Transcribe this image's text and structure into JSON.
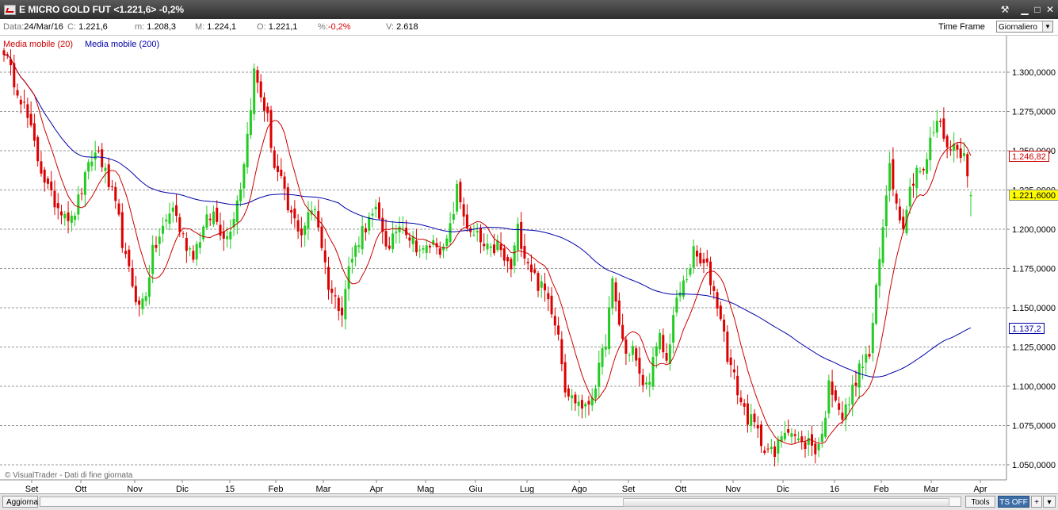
{
  "window": {
    "title": "E MICRO GOLD FUT <1.221,6> -0,2%",
    "buttons": [
      "tools-icon",
      "minimize-icon",
      "maximize-icon",
      "close-icon"
    ]
  },
  "info": {
    "data_label": "Data:",
    "data_value": "24/Mar/16",
    "c_label": "C:",
    "c_value": "1.221,6",
    "m_label": "m:",
    "m_value": "1.208,3",
    "M_label": "M:",
    "M_value": "1.224,1",
    "o_label": "O:",
    "o_value": "1.221,1",
    "pct_label": "%:",
    "pct_value": "-0,2%",
    "v_label": "V:",
    "v_value": "2.618",
    "timeframe_label": "Time Frame",
    "timeframe_value": "Giornaliero"
  },
  "legend": {
    "ma20": "Media mobile (20)",
    "ma200": "Media mobile (200)"
  },
  "tags": {
    "ma20_value": "1.246,82",
    "last_price": "1.221,6000",
    "ma200_value": "1.137,2"
  },
  "watermark": "© VisualTrader - Dati di fine giornata",
  "status": {
    "refresh": "Aggiorna",
    "tools": "Tools",
    "ts": "TS OFF",
    "plus": "+",
    "menu": "▾"
  },
  "colors": {
    "up": "#22cc22",
    "down": "#dd0000",
    "ma20": "#cc0000",
    "ma200": "#0000aa",
    "grid": "#999999",
    "last_price_bg": "#ffff00"
  },
  "chart_data": {
    "type": "candlestick",
    "instrument": "E MICRO GOLD FUT",
    "y_ticks": [
      "1.300,0000",
      "1.275,0000",
      "1.250,0000",
      "1.225,0000",
      "1.200,0000",
      "1.175,0000",
      "1.150,0000",
      "1.125,0000",
      "1.100,0000",
      "1.075,0000",
      "1.050,0000"
    ],
    "y_tick_values": [
      1300,
      1275,
      1250,
      1225,
      1200,
      1175,
      1150,
      1125,
      1100,
      1075,
      1050
    ],
    "ylim": [
      1038,
      1322
    ],
    "x_labels": [
      "Set",
      "Ott",
      "Nov",
      "Dic",
      "15",
      "Feb",
      "Mar",
      "Apr",
      "Mag",
      "Giu",
      "Lug",
      "Ago",
      "Set",
      "Ott",
      "Nov",
      "Dic",
      "16",
      "Feb",
      "Mar",
      "Apr"
    ],
    "close_anchors": [
      1315,
      1300,
      1290,
      1278,
      1262,
      1245,
      1232,
      1220,
      1215,
      1212,
      1205,
      1218,
      1232,
      1245,
      1250,
      1235,
      1222,
      1205,
      1180,
      1165,
      1150,
      1160,
      1185,
      1195,
      1205,
      1215,
      1200,
      1190,
      1185,
      1195,
      1205,
      1210,
      1200,
      1195,
      1210,
      1228,
      1260,
      1300,
      1285,
      1270,
      1240,
      1230,
      1212,
      1205,
      1198,
      1208,
      1215,
      1190,
      1165,
      1155,
      1150,
      1175,
      1188,
      1200,
      1205,
      1210,
      1200,
      1185,
      1200,
      1205,
      1195,
      1190,
      1185,
      1190,
      1192,
      1185,
      1200,
      1225,
      1210,
      1195,
      1195,
      1188,
      1185,
      1190,
      1180,
      1175,
      1200,
      1185,
      1175,
      1165,
      1160,
      1150,
      1135,
      1100,
      1092,
      1090,
      1085,
      1095,
      1110,
      1130,
      1165,
      1140,
      1120,
      1125,
      1105,
      1100,
      1115,
      1130,
      1115,
      1145,
      1160,
      1170,
      1185,
      1178,
      1175,
      1160,
      1145,
      1120,
      1105,
      1090,
      1080,
      1075,
      1065,
      1060,
      1055,
      1070,
      1075,
      1068,
      1062,
      1065,
      1060,
      1068,
      1100,
      1095,
      1080,
      1090,
      1105,
      1115,
      1120,
      1160,
      1200,
      1245,
      1215,
      1205,
      1225,
      1240,
      1235,
      1255,
      1270,
      1260,
      1250,
      1255,
      1245,
      1222
    ],
    "series": [
      {
        "name": "Media mobile (20)",
        "period": 20,
        "last": 1246.82
      },
      {
        "name": "Media mobile (200)",
        "period": 200,
        "last": 1137.2
      }
    ],
    "last": {
      "date": "24/Mar/16",
      "open": 1221.1,
      "high": 1224.1,
      "low": 1208.3,
      "close": 1221.6,
      "change_pct": -0.2,
      "volume": 2618
    }
  }
}
